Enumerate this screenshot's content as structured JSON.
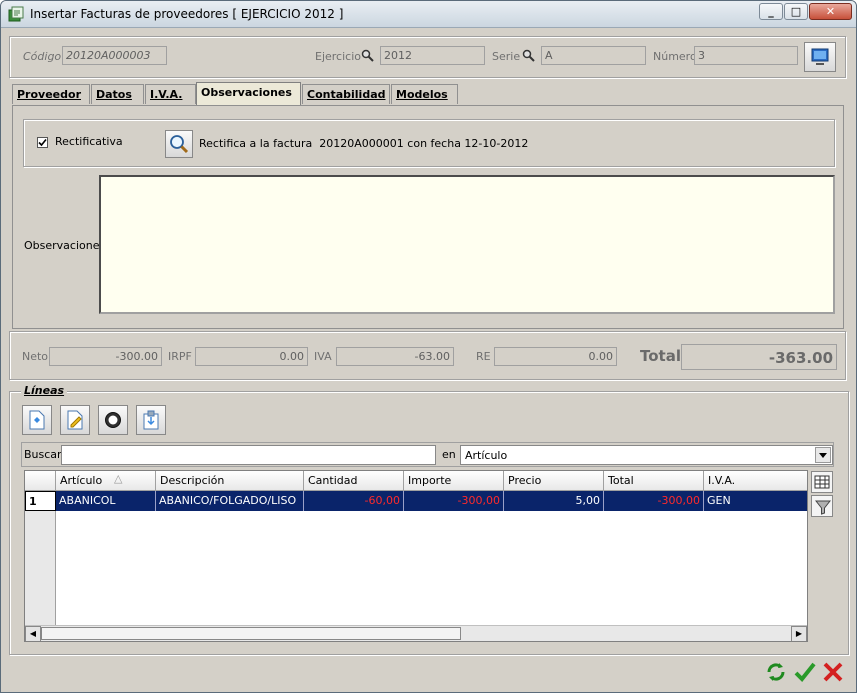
{
  "window": {
    "title": "Insertar Facturas de proveedores [ EJERCICIO 2012 ]"
  },
  "header": {
    "codigo_label": "Código",
    "codigo_value": "20120A000003",
    "ejercicio_label": "Ejercicio",
    "ejercicio_value": "2012",
    "serie_label": "Serie",
    "serie_value": "A",
    "numero_label": "Número",
    "numero_value": "3"
  },
  "tabs": [
    {
      "label": "Proveedor"
    },
    {
      "label": "Datos"
    },
    {
      "label": "I.V.A."
    },
    {
      "label": "Observaciones",
      "active": true
    },
    {
      "label": "Contabilidad"
    },
    {
      "label": "Modelos"
    }
  ],
  "observaciones": {
    "rectificativa_label": "Rectificativa",
    "rectificativa_checked": true,
    "rectifica_text": "Rectifica a la factura  20120A000001 con fecha 12-10-2012",
    "observaciones_label": "Observaciones",
    "observaciones_value": ""
  },
  "totals": {
    "neto_label": "Neto",
    "neto_value": "-300.00",
    "irpf_label": "IRPF",
    "irpf_value": "0.00",
    "iva_label": "IVA",
    "iva_value": "-63.00",
    "re_label": "RE",
    "re_value": "0.00",
    "total_label": "Total",
    "total_value": "-363.00"
  },
  "lineas": {
    "title": "Líneas",
    "buscar_label": "Buscar",
    "buscar_value": "",
    "en_label": "en",
    "en_value": "Artículo",
    "columns": [
      "Artículo",
      "Descripción",
      "Cantidad",
      "Importe",
      "Precio",
      "Total",
      "I.V.A."
    ],
    "rows": [
      {
        "index": "1",
        "articulo": "ABANICOL",
        "descripcion": "ABANICO/FOLGADO/LISO",
        "cantidad": "-60,00",
        "importe": "-300,00",
        "precio": "5,00",
        "total": "-300,00",
        "iva": "GEN"
      }
    ]
  },
  "colors": {
    "selected_row": "#0a246a",
    "negative": "#ff2a2a",
    "panel_bg": "#fffff0"
  }
}
